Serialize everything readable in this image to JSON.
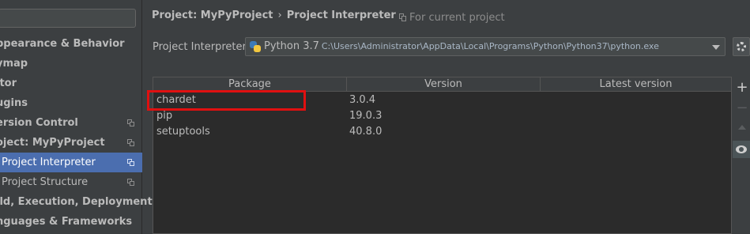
{
  "sidebar": {
    "search": {
      "value": ""
    },
    "items": [
      {
        "label": "ppearance & Behavior",
        "level": 0,
        "selected": false,
        "copy_icon": false
      },
      {
        "label": "ymap",
        "level": 0,
        "selected": false,
        "copy_icon": false
      },
      {
        "label": "itor",
        "level": 0,
        "selected": false,
        "copy_icon": false
      },
      {
        "label": "ugins",
        "level": 0,
        "selected": false,
        "copy_icon": false
      },
      {
        "label": "ersion Control",
        "level": 0,
        "selected": false,
        "copy_icon": true
      },
      {
        "label": "oject: MyPyProject",
        "level": 0,
        "selected": false,
        "copy_icon": true
      },
      {
        "label": "Project Interpreter",
        "level": 1,
        "selected": true,
        "copy_icon": true
      },
      {
        "label": "Project Structure",
        "level": 1,
        "selected": false,
        "copy_icon": true
      },
      {
        "label": "ild, Execution, Deployment",
        "level": 0,
        "selected": false,
        "copy_icon": false
      },
      {
        "label": "nguages & Frameworks",
        "level": 0,
        "selected": false,
        "copy_icon": false
      }
    ]
  },
  "header": {
    "breadcrumb_project": "Project: MyPyProject",
    "breadcrumb_sep": "›",
    "breadcrumb_page": "Project Interpreter",
    "for_current_project": "For current project"
  },
  "interpreter": {
    "label": "Project Interpreter:",
    "name": "Python 3.7",
    "path": "C:\\Users\\Administrator\\AppData\\Local\\Programs\\Python\\Python37\\python.exe"
  },
  "packages": {
    "columns": [
      "Package",
      "Version",
      "Latest version"
    ],
    "rows": [
      {
        "package": "chardet",
        "version": "3.0.4",
        "latest": ""
      },
      {
        "package": "pip",
        "version": "19.0.3",
        "latest": ""
      },
      {
        "package": "setuptools",
        "version": "40.8.0",
        "latest": ""
      }
    ],
    "highlighted_row": 0
  },
  "side_tools": {
    "add": "+",
    "remove": "−"
  },
  "colors": {
    "background": "#3c3f41",
    "table_background": "#2b2b2b",
    "selection": "#4b6eaf",
    "highlight_box": "#e01010"
  },
  "icons": {
    "python": "python-icon",
    "gear": "gear-icon",
    "eye": "eye-icon",
    "copy": "copy-icon"
  }
}
